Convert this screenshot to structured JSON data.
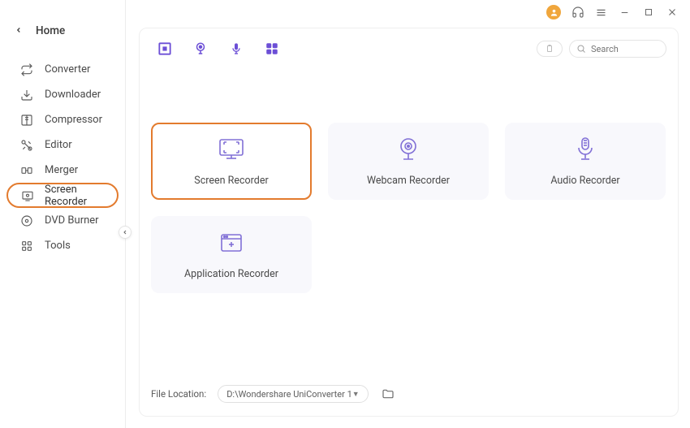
{
  "sidebar": {
    "home": "Home",
    "items": [
      {
        "label": "Converter"
      },
      {
        "label": "Downloader"
      },
      {
        "label": "Compressor"
      },
      {
        "label": "Editor"
      },
      {
        "label": "Merger"
      },
      {
        "label": "Screen Recorder"
      },
      {
        "label": "DVD Burner"
      },
      {
        "label": "Tools"
      }
    ]
  },
  "search": {
    "placeholder": "Search"
  },
  "cards": [
    {
      "label": "Screen Recorder"
    },
    {
      "label": "Webcam Recorder"
    },
    {
      "label": "Audio Recorder"
    },
    {
      "label": "Application Recorder"
    }
  ],
  "footer": {
    "label": "File Location:",
    "path": "D:\\Wondershare UniConverter 1"
  }
}
